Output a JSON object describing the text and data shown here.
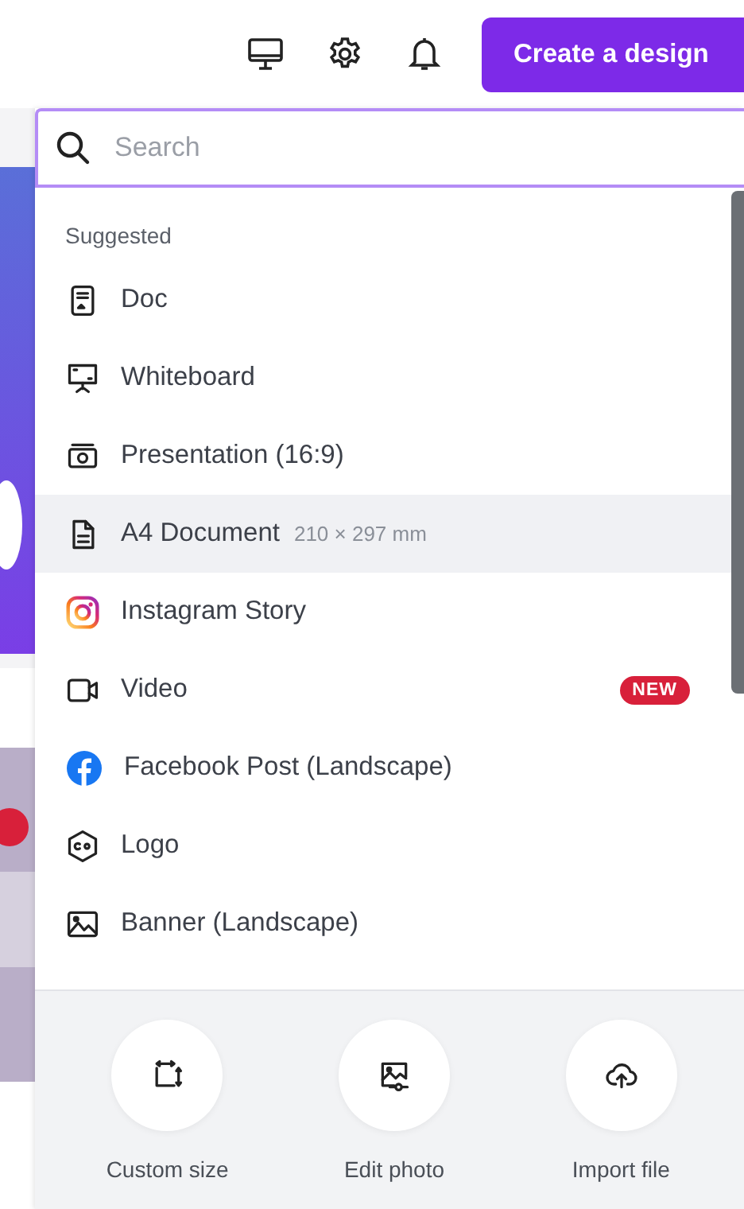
{
  "header": {
    "create_button": "Create a design"
  },
  "search": {
    "placeholder": "Search"
  },
  "section_title": "Suggested",
  "items": [
    {
      "label": "Doc",
      "selected": false
    },
    {
      "label": "Whiteboard",
      "selected": false
    },
    {
      "label": "Presentation (16:9)",
      "selected": false
    },
    {
      "label": "A4 Document",
      "detail": "210 × 297 mm",
      "selected": true
    },
    {
      "label": "Instagram Story",
      "selected": false
    },
    {
      "label": "Video",
      "badge": "NEW",
      "selected": false
    },
    {
      "label": "Facebook Post (Landscape)",
      "selected": false
    },
    {
      "label": "Logo",
      "selected": false
    },
    {
      "label": "Banner (Landscape)",
      "selected": false
    }
  ],
  "actions": [
    {
      "label": "Custom size"
    },
    {
      "label": "Edit photo"
    },
    {
      "label": "Import file"
    }
  ]
}
